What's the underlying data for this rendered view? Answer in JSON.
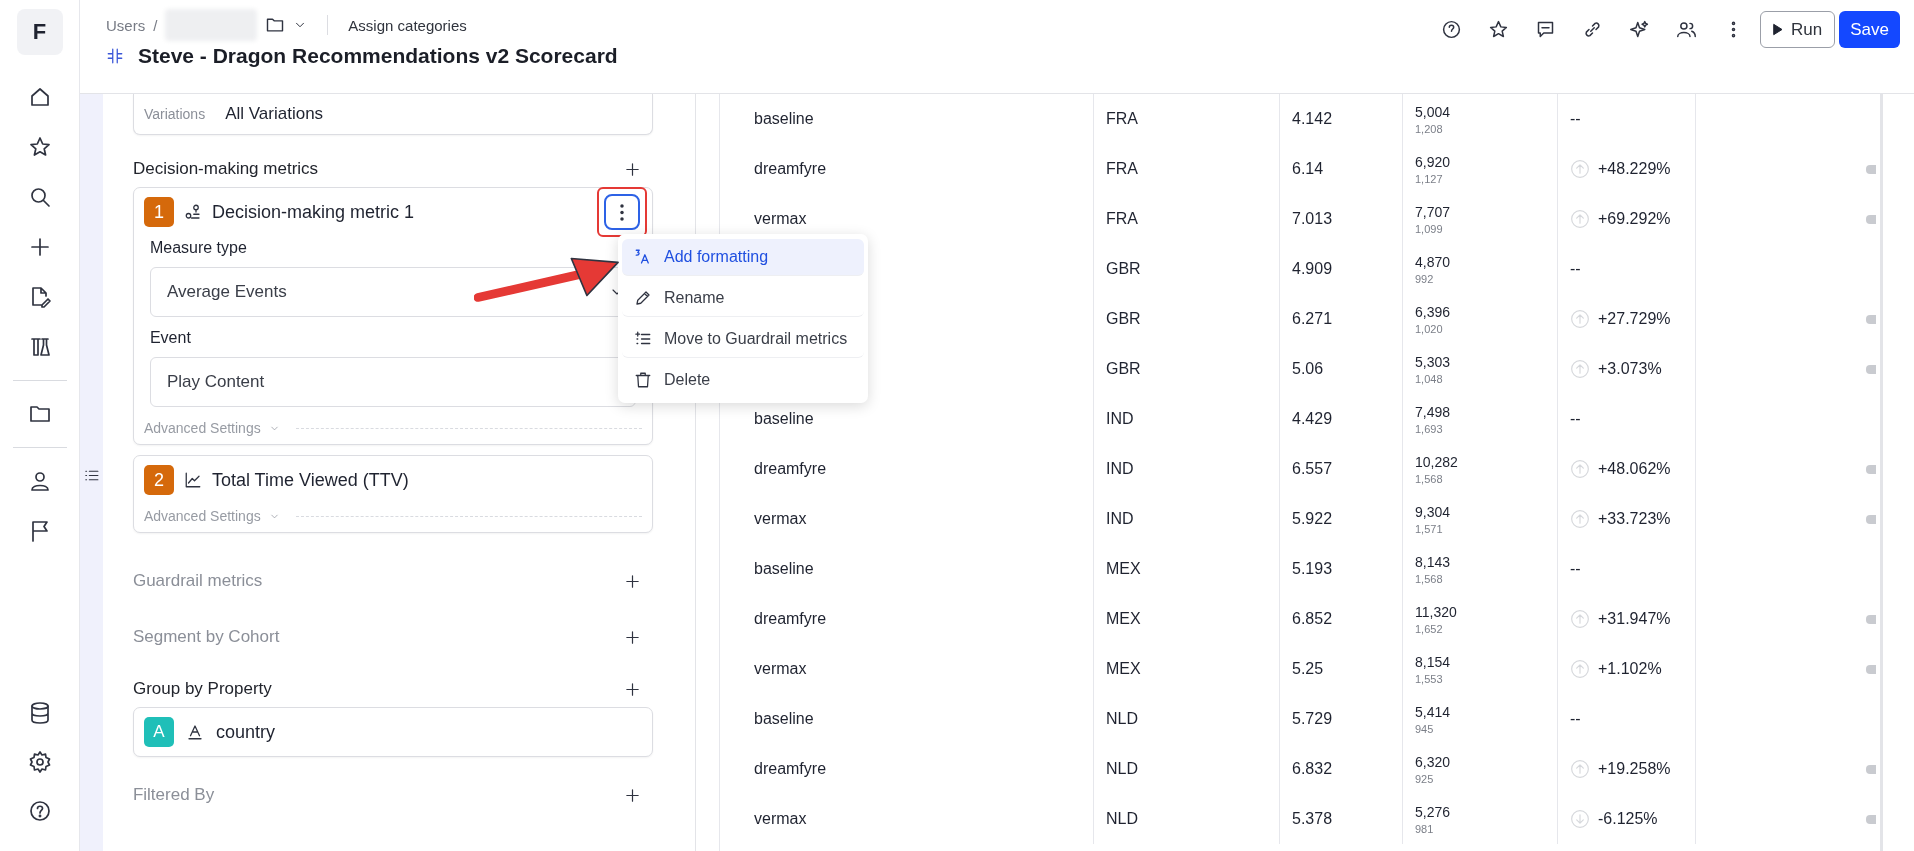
{
  "logo": "F",
  "breadcrumb": {
    "root": "Users",
    "separator": "/",
    "action": "Assign categories"
  },
  "title": "Steve - Dragon Recommendations v2 Scorecard",
  "toolbar": {
    "run": "Run",
    "save": "Save"
  },
  "variations": {
    "label": "Variations",
    "value": "All Variations"
  },
  "decision_metrics": {
    "title": "Decision-making metrics",
    "active": true,
    "metrics": [
      {
        "number": "1",
        "name": "Decision-making metric 1",
        "kind": "events",
        "menu_open": true,
        "measure_label": "Measure type",
        "measure": "Average Events",
        "event_label": "Event",
        "event": "Play Content",
        "advanced": "Advanced Settings"
      },
      {
        "number": "2",
        "name": "Total Time Viewed (TTV)",
        "kind": "chart",
        "advanced": "Advanced Settings"
      }
    ]
  },
  "guardrail": {
    "title": "Guardrail metrics",
    "active": false
  },
  "segment": {
    "title": "Segment by Cohort",
    "active": false
  },
  "group": {
    "title": "Group by Property",
    "active": true,
    "items": [
      {
        "badge": "A",
        "name": "country"
      }
    ]
  },
  "filter": {
    "title": "Filtered By",
    "active": false
  },
  "menu": {
    "items": [
      {
        "label": "Add formatting",
        "kind": "format",
        "selected": true
      },
      {
        "label": "Rename",
        "kind": "rename",
        "selected": false
      },
      {
        "label": "Move to Guardrail metrics",
        "kind": "move",
        "selected": false
      },
      {
        "label": "Delete",
        "kind": "delete",
        "selected": false
      }
    ]
  },
  "table": {
    "rows": [
      {
        "variant": "baseline",
        "country": "FRA",
        "value": "4.142",
        "count": "5,004",
        "sub": "1,208",
        "change": "--"
      },
      {
        "variant": "dreamfyre",
        "country": "FRA",
        "value": "6.14",
        "count": "6,920",
        "sub": "1,127",
        "change": "+48.229%",
        "kind": "up"
      },
      {
        "variant": "vermax",
        "country": "FRA",
        "value": "7.013",
        "count": "7,707",
        "sub": "1,099",
        "change": "+69.292%",
        "kind": "up"
      },
      {
        "country": "GBR",
        "value": "4.909",
        "count": "4,870",
        "sub": "992",
        "change": "--"
      },
      {
        "country": "GBR",
        "value": "6.271",
        "count": "6,396",
        "sub": "1,020",
        "change": "+27.729%",
        "kind": "up"
      },
      {
        "country": "GBR",
        "value": "5.06",
        "count": "5,303",
        "sub": "1,048",
        "change": "+3.073%",
        "kind": "up"
      },
      {
        "variant": "baseline",
        "country": "IND",
        "value": "4.429",
        "count": "7,498",
        "sub": "1,693",
        "change": "--"
      },
      {
        "variant": "dreamfyre",
        "country": "IND",
        "value": "6.557",
        "count": "10,282",
        "sub": "1,568",
        "change": "+48.062%",
        "kind": "up"
      },
      {
        "variant": "vermax",
        "country": "IND",
        "value": "5.922",
        "count": "9,304",
        "sub": "1,571",
        "change": "+33.723%",
        "kind": "up"
      },
      {
        "variant": "baseline",
        "country": "MEX",
        "value": "5.193",
        "count": "8,143",
        "sub": "1,568",
        "change": "--"
      },
      {
        "variant": "dreamfyre",
        "country": "MEX",
        "value": "6.852",
        "count": "11,320",
        "sub": "1,652",
        "change": "+31.947%",
        "kind": "up"
      },
      {
        "variant": "vermax",
        "country": "MEX",
        "value": "5.25",
        "count": "8,154",
        "sub": "1,553",
        "change": "+1.102%",
        "kind": "up"
      },
      {
        "variant": "baseline",
        "country": "NLD",
        "value": "5.729",
        "count": "5,414",
        "sub": "945",
        "change": "--"
      },
      {
        "variant": "dreamfyre",
        "country": "NLD",
        "value": "6.832",
        "count": "6,320",
        "sub": "925",
        "change": "+19.258%",
        "kind": "up"
      },
      {
        "variant": "vermax",
        "country": "NLD",
        "value": "5.378",
        "count": "5,276",
        "sub": "981",
        "change": "-6.125%",
        "kind": "down"
      }
    ]
  }
}
